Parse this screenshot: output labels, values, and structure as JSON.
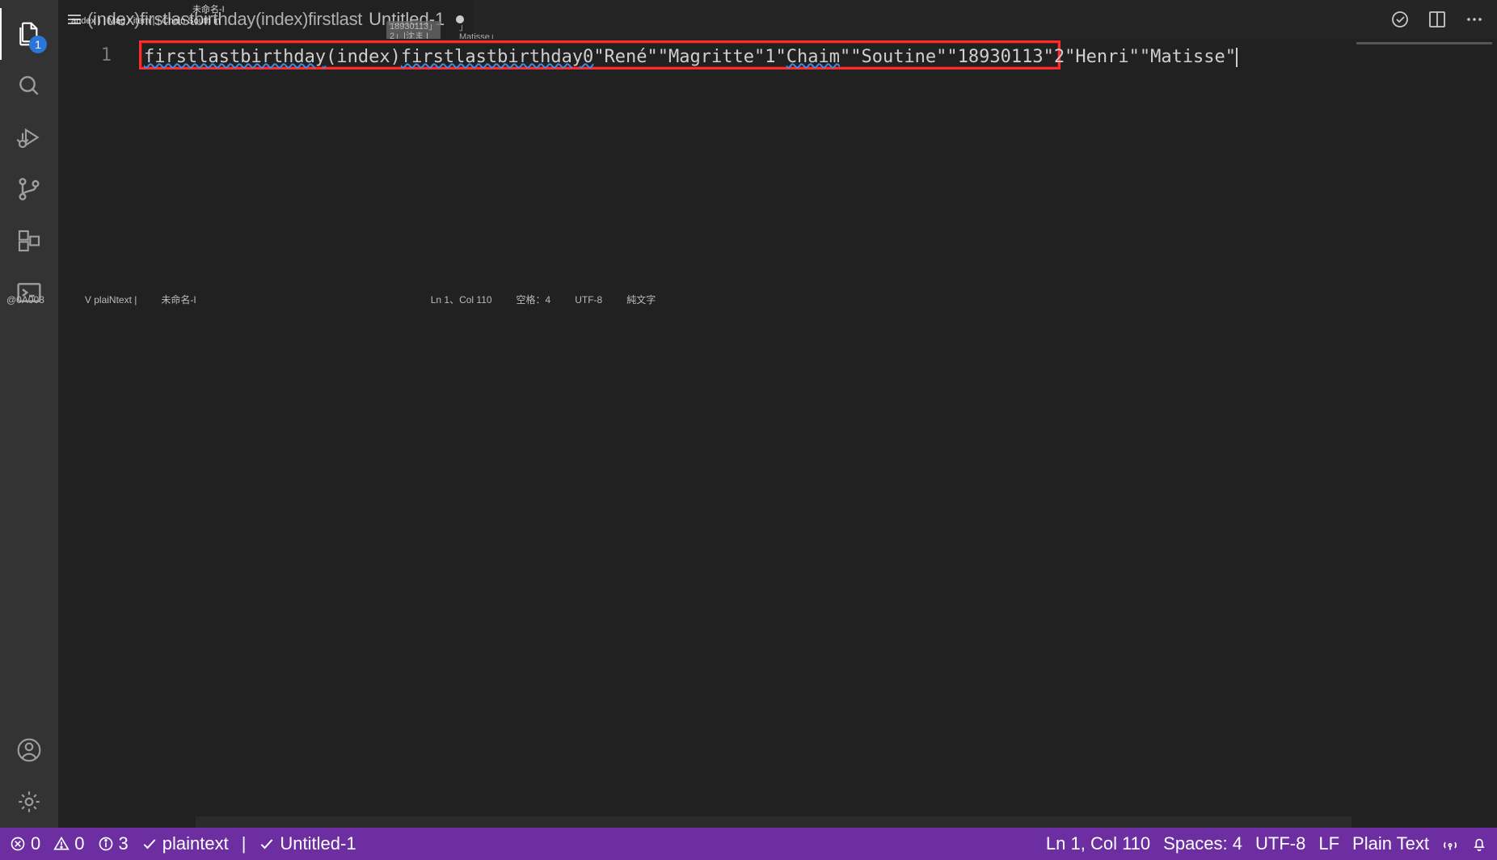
{
  "activity_bar": {
    "explorer_badge": "1"
  },
  "tabs": {
    "breadcrumb": "(index)firstlastbirthday(index)firstlast",
    "filename": "Untitled-1"
  },
  "ghost": {
    "line1": "未命名-I",
    "line2": "andex ) | Mag r item  |  | Chain South in",
    "chip": "18930113」2」|沈ま I",
    "tail": "」Matisse」"
  },
  "editor": {
    "line_number": "1",
    "code_seg1": "firstlastbirthday",
    "code_seg2": "(index)",
    "code_seg3": "firstlastbirthday0",
    "code_seg4": "\"René\"\"Magritte\"1\"",
    "code_seg5": "Chaim",
    "code_seg6": "\"\"Soutine\"\"18930113\"2\"Henri\"\"Matisse\""
  },
  "mid_ghost": {
    "a": "@0A003",
    "b": "V plaiNtext |",
    "c": "未命名-I",
    "d": "Ln 1、Col 110",
    "e": "空格：4",
    "f": "UTF-8",
    "g": "純文字"
  },
  "status": {
    "errors": "0",
    "warnings": "0",
    "info": "3",
    "lang_check": "plaintext",
    "separator": "|",
    "file_check": "Untitled-1",
    "cursor": "Ln 1, Col 110",
    "spaces": "Spaces: 4",
    "encoding": "UTF-8",
    "eol": "LF",
    "mode": "Plain Text"
  }
}
